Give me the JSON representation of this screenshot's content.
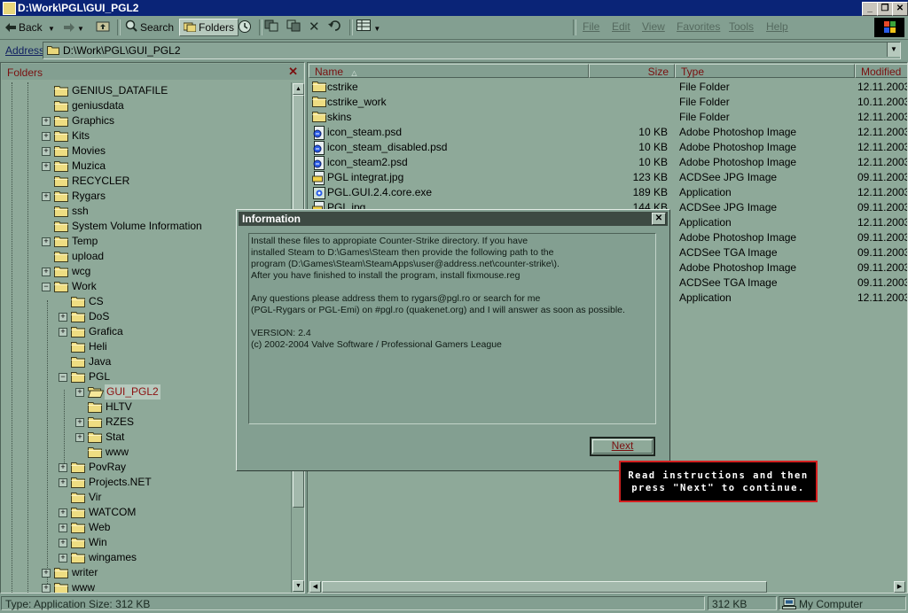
{
  "window": {
    "title": "D:\\Work\\PGL\\GUI_PGL2"
  },
  "toolbar": {
    "back_label": "Back",
    "search_label": "Search",
    "folders_label": "Folders",
    "menus": [
      "File",
      "Edit",
      "View",
      "Favorites",
      "Tools",
      "Help"
    ]
  },
  "address": {
    "label": "Address",
    "value": "D:\\Work\\PGL\\GUI_PGL2"
  },
  "folder_pane": {
    "title": "Folders",
    "close_glyph": "✕",
    "nodes": [
      {
        "label": "GENIUS_DATAFILE",
        "level": 0,
        "expander": "",
        "selected": false
      },
      {
        "label": "geniusdata",
        "level": 0,
        "expander": "",
        "selected": false
      },
      {
        "label": "Graphics",
        "level": 0,
        "expander": "+",
        "selected": false
      },
      {
        "label": "Kits",
        "level": 0,
        "expander": "+",
        "selected": false
      },
      {
        "label": "Movies",
        "level": 0,
        "expander": "+",
        "selected": false
      },
      {
        "label": "Muzica",
        "level": 0,
        "expander": "+",
        "selected": false
      },
      {
        "label": "RECYCLER",
        "level": 0,
        "expander": "",
        "selected": false
      },
      {
        "label": "Rygars",
        "level": 0,
        "expander": "+",
        "selected": false
      },
      {
        "label": "ssh",
        "level": 0,
        "expander": "",
        "selected": false
      },
      {
        "label": "System Volume Information",
        "level": 0,
        "expander": "",
        "selected": false
      },
      {
        "label": "Temp",
        "level": 0,
        "expander": "+",
        "selected": false
      },
      {
        "label": "upload",
        "level": 0,
        "expander": "",
        "selected": false
      },
      {
        "label": "wcg",
        "level": 0,
        "expander": "+",
        "selected": false
      },
      {
        "label": "Work",
        "level": 0,
        "expander": "−",
        "selected": false
      },
      {
        "label": "CS",
        "level": 1,
        "expander": "",
        "selected": false
      },
      {
        "label": "DoS",
        "level": 1,
        "expander": "+",
        "selected": false
      },
      {
        "label": "Grafica",
        "level": 1,
        "expander": "+",
        "selected": false
      },
      {
        "label": "Heli",
        "level": 1,
        "expander": "",
        "selected": false
      },
      {
        "label": "Java",
        "level": 1,
        "expander": "",
        "selected": false
      },
      {
        "label": "PGL",
        "level": 1,
        "expander": "−",
        "selected": false
      },
      {
        "label": "GUI_PGL2",
        "level": 2,
        "expander": "+",
        "selected": true
      },
      {
        "label": "HLTV",
        "level": 2,
        "expander": "",
        "selected": false
      },
      {
        "label": "RZES",
        "level": 2,
        "expander": "+",
        "selected": false
      },
      {
        "label": "Stat",
        "level": 2,
        "expander": "+",
        "selected": false
      },
      {
        "label": "www",
        "level": 2,
        "expander": "",
        "selected": false
      },
      {
        "label": "PovRay",
        "level": 1,
        "expander": "+",
        "selected": false
      },
      {
        "label": "Projects.NET",
        "level": 1,
        "expander": "+",
        "selected": false
      },
      {
        "label": "Vir",
        "level": 1,
        "expander": "",
        "selected": false
      },
      {
        "label": "WATCOM",
        "level": 1,
        "expander": "+",
        "selected": false
      },
      {
        "label": "Web",
        "level": 1,
        "expander": "+",
        "selected": false
      },
      {
        "label": "Win",
        "level": 1,
        "expander": "+",
        "selected": false
      },
      {
        "label": "wingames",
        "level": 1,
        "expander": "+",
        "selected": false
      },
      {
        "label": "writer",
        "level": 0,
        "expander": "+",
        "selected": false
      },
      {
        "label": "www",
        "level": 0,
        "expander": "+",
        "selected": false
      }
    ]
  },
  "file_list": {
    "columns": {
      "name": "Name",
      "size": "Size",
      "type": "Type",
      "modified": "Modified"
    },
    "rows": [
      {
        "name": "cstrike",
        "size": "",
        "type": "File Folder",
        "modified": "12.11.2003",
        "icon": "folder-icon"
      },
      {
        "name": "cstrike_work",
        "size": "",
        "type": "File Folder",
        "modified": "10.11.2003",
        "icon": "folder-icon"
      },
      {
        "name": "skins",
        "size": "",
        "type": "File Folder",
        "modified": "12.11.2003",
        "icon": "folder-icon"
      },
      {
        "name": "icon_steam.psd",
        "size": "10 KB",
        "type": "Adobe Photoshop Image",
        "modified": "12.11.2003",
        "icon": "psd-icon"
      },
      {
        "name": "icon_steam_disabled.psd",
        "size": "10 KB",
        "type": "Adobe Photoshop Image",
        "modified": "12.11.2003",
        "icon": "psd-icon"
      },
      {
        "name": "icon_steam2.psd",
        "size": "10 KB",
        "type": "Adobe Photoshop Image",
        "modified": "12.11.2003",
        "icon": "psd-icon"
      },
      {
        "name": "PGL integrat.jpg",
        "size": "123 KB",
        "type": "ACDSee JPG Image",
        "modified": "09.11.2003",
        "icon": "jpg-icon"
      },
      {
        "name": "PGL.GUI.2.4.core.exe",
        "size": "189 KB",
        "type": "Application",
        "modified": "12.11.2003",
        "icon": "exe-icon"
      },
      {
        "name": "PGL.jpg",
        "size": "144 KB",
        "type": "ACDSee JPG Image",
        "modified": "09.11.2003",
        "icon": "jpg-icon"
      },
      {
        "name": "",
        "size": "",
        "type": "Application",
        "modified": "12.11.2003",
        "icon": ""
      },
      {
        "name": "",
        "size": "",
        "type": "Adobe Photoshop Image",
        "modified": "09.11.2003",
        "icon": ""
      },
      {
        "name": "",
        "size": "",
        "type": "ACDSee TGA Image",
        "modified": "09.11.2003",
        "icon": ""
      },
      {
        "name": "",
        "size": "",
        "type": "Adobe Photoshop Image",
        "modified": "09.11.2003",
        "icon": ""
      },
      {
        "name": "",
        "size": "",
        "type": "ACDSee TGA Image",
        "modified": "09.11.2003",
        "icon": ""
      },
      {
        "name": "",
        "size": "",
        "type": "Application",
        "modified": "12.11.2003",
        "icon": ""
      }
    ]
  },
  "dialog": {
    "title": "Information",
    "close_glyph": "✕",
    "lines": [
      "Install these files to appropiate Counter-Strike directory. If you have",
      "installed Steam to D:\\Games\\Steam then provide the following path to the",
      "program (D:\\Games\\Steam\\SteamApps\\user@address.net\\counter-strike\\).",
      "After you have finished to install the program, install fixmouse.reg",
      "",
      "Any questions please address them to rygars@pgl.ro or search for me",
      "(PGL-Rygars or PGL-Emi) on #pgl.ro (quakenet.org) and I will answer as soon as possible.",
      "",
      "VERSION: 2.4",
      "(c) 2002-2004 Valve Software / Professional Gamers League"
    ],
    "next_label": "Next"
  },
  "callout": {
    "line1": "Read instructions and then",
    "line2": "press \"Next\" to continue."
  },
  "statusbar": {
    "type_text": "Type: Application Size: 312 KB",
    "size_text": "312 KB",
    "zone_text": "My Computer"
  },
  "colors": {
    "window_bg": "#839f91",
    "pane_bg": "#8ea999",
    "title_bar": "#0a2477",
    "accent_text": "#7a1010",
    "callout_border": "#d42020"
  }
}
